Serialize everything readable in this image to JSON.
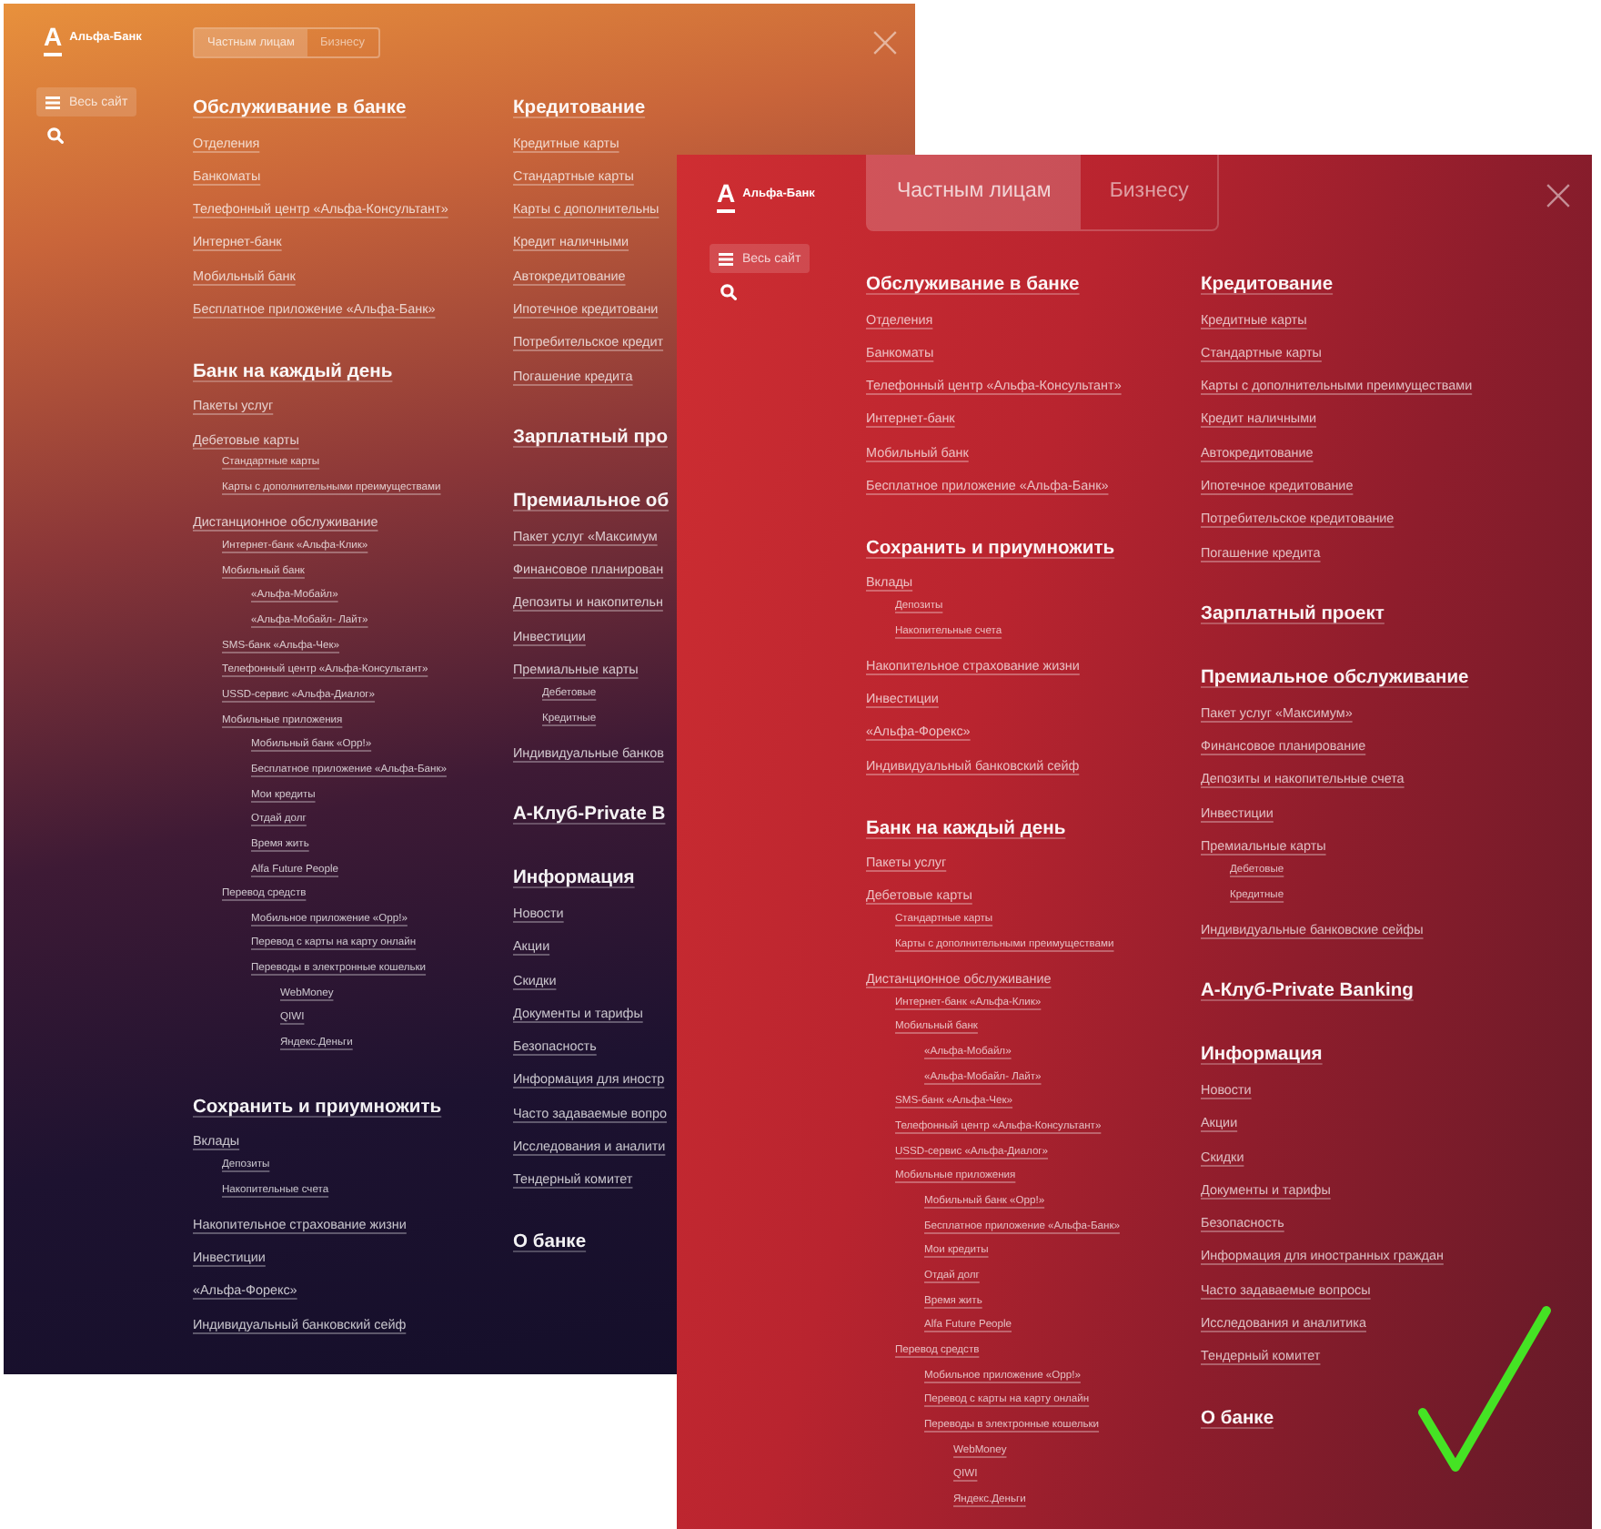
{
  "panels": [
    {
      "kind": "old",
      "logo": {
        "mark": "А",
        "name": "Альфа-Банк"
      },
      "tabs": [
        {
          "label": "Частным лицам",
          "selected": true
        },
        {
          "label": "Бизнесу",
          "selected": false
        }
      ],
      "all_site_button": "Весь сайт",
      "columns": [
        [
          {
            "heading": "Обслуживание в банке",
            "items": [
              {
                "label": "Отделения"
              },
              {
                "label": "Банкоматы"
              },
              {
                "label": "Телефонный центр «Альфа-Консультант»"
              },
              {
                "label": "Интернет-банк"
              },
              {
                "label": "Мобильный банк"
              },
              {
                "label": "Бесплатное приложение «Альфа-Банк»"
              }
            ]
          },
          {
            "heading": "Банк на каждый день",
            "items": [
              {
                "label": "Пакеты услуг"
              },
              {
                "label": "Дебетовые карты",
                "children": [
                  {
                    "label": "Стандартные карты"
                  },
                  {
                    "label": "Карты с дополнительными преимуществами"
                  }
                ]
              },
              {
                "label": "Дистанционное обслуживание",
                "children": [
                  {
                    "label": "Интернет-банк «Альфа-Клик»"
                  },
                  {
                    "label": "Мобильный банк",
                    "children": [
                      {
                        "label": "«Альфа-Мобайл»"
                      },
                      {
                        "label": "«Альфа-Мобайл- Лайт»"
                      }
                    ]
                  },
                  {
                    "label": "SMS-банк «Альфа-Чек»"
                  },
                  {
                    "label": "Телефонный центр «Альфа-Консультант»"
                  },
                  {
                    "label": "USSD-сервис «Альфа-Диалог»"
                  },
                  {
                    "label": "Мобильные приложения",
                    "children": [
                      {
                        "label": "Мобильный банк «Opp!»"
                      },
                      {
                        "label": "Бесплатное приложение «Альфа-Банк»"
                      },
                      {
                        "label": "Мои кредиты"
                      },
                      {
                        "label": "Отдай долг"
                      },
                      {
                        "label": "Время жить"
                      },
                      {
                        "label": "Alfa Future People"
                      }
                    ]
                  },
                  {
                    "label": "Перевод средств",
                    "children": [
                      {
                        "label": "Мобильное приложение «Opp!»"
                      },
                      {
                        "label": "Перевод с карты на карту онлайн"
                      },
                      {
                        "label": "Переводы в электронные кошельки",
                        "children": [
                          {
                            "label": "WebMoney"
                          },
                          {
                            "label": "QIWI"
                          },
                          {
                            "label": "Яндекс.Деньги"
                          }
                        ]
                      }
                    ]
                  }
                ]
              }
            ]
          },
          {
            "heading": "Сохранить и приумножить",
            "items": [
              {
                "label": "Вклады",
                "children": [
                  {
                    "label": "Депозиты"
                  },
                  {
                    "label": "Накопительные счета"
                  }
                ]
              },
              {
                "label": "Накопительное страхование жизни"
              },
              {
                "label": "Инвестиции"
              },
              {
                "label": "«Альфа-Форекс»"
              },
              {
                "label": "Индивидуальный банковский сейф"
              }
            ]
          }
        ],
        [
          {
            "heading": "Кредитование",
            "items": [
              {
                "label": "Кредитные карты"
              },
              {
                "label": "Стандартные карты"
              },
              {
                "label": "Карты с дополнительны"
              },
              {
                "label": "Кредит наличными"
              },
              {
                "label": "Автокредитование"
              },
              {
                "label": "Ипотечное кредитовани"
              },
              {
                "label": "Потребительское кредит"
              },
              {
                "label": "Погашение кредита"
              }
            ]
          },
          {
            "heading": "Зарплатный про"
          },
          {
            "heading": "Премиальное об",
            "items": [
              {
                "label": "Пакет услуг «Максимум"
              },
              {
                "label": "Финансовое планирован"
              },
              {
                "label": "Депозиты и накопительн"
              },
              {
                "label": "Инвестиции"
              },
              {
                "label": "Премиальные карты",
                "children": [
                  {
                    "label": "Дебетовые"
                  },
                  {
                    "label": "Кредитные"
                  }
                ]
              },
              {
                "label": "Индивидуальные банков"
              }
            ]
          },
          {
            "heading": "А-Клуб-Private B"
          },
          {
            "heading": "Информация",
            "items": [
              {
                "label": "Новости"
              },
              {
                "label": "Акции"
              },
              {
                "label": "Скидки"
              },
              {
                "label": "Документы и тарифы"
              },
              {
                "label": "Безопасность"
              },
              {
                "label": "Информация для иностр"
              },
              {
                "label": "Часто задаваемые вопро"
              },
              {
                "label": "Исследования и аналити"
              },
              {
                "label": "Тендерный комитет"
              }
            ]
          },
          {
            "heading": "О банке"
          }
        ]
      ]
    },
    {
      "kind": "new",
      "logo": {
        "mark": "А",
        "name": "Альфа-Банк"
      },
      "tabs": [
        {
          "label": "Частным лицам",
          "selected": true
        },
        {
          "label": "Бизнесу",
          "selected": false
        }
      ],
      "all_site_button": "Весь сайт",
      "columns": [
        [
          {
            "heading": "Обслуживание в банке",
            "items": [
              {
                "label": "Отделения"
              },
              {
                "label": "Банкоматы"
              },
              {
                "label": "Телефонный центр «Альфа-Консультант»"
              },
              {
                "label": "Интернет-банк"
              },
              {
                "label": "Мобильный банк"
              },
              {
                "label": "Бесплатное приложение «Альфа-Банк»"
              }
            ]
          },
          {
            "heading": "Сохранить и приумножить",
            "items": [
              {
                "label": "Вклады",
                "children": [
                  {
                    "label": "Депозиты"
                  },
                  {
                    "label": "Накопительные счета"
                  }
                ]
              },
              {
                "label": "Накопительное страхование жизни"
              },
              {
                "label": "Инвестиции"
              },
              {
                "label": "«Альфа-Форекс»"
              },
              {
                "label": "Индивидуальный банковский сейф"
              }
            ]
          },
          {
            "heading": "Банк на каждый день",
            "items": [
              {
                "label": "Пакеты услуг"
              },
              {
                "label": "Дебетовые карты",
                "children": [
                  {
                    "label": "Стандартные карты"
                  },
                  {
                    "label": "Карты с дополнительными преимуществами"
                  }
                ]
              },
              {
                "label": "Дистанционное обслуживание",
                "children": [
                  {
                    "label": "Интернет-банк «Альфа-Клик»"
                  },
                  {
                    "label": "Мобильный банк",
                    "children": [
                      {
                        "label": "«Альфа-Мобайл»"
                      },
                      {
                        "label": "«Альфа-Мобайл- Лайт»"
                      }
                    ]
                  },
                  {
                    "label": "SMS-банк «Альфа-Чек»"
                  },
                  {
                    "label": "Телефонный центр «Альфа-Консультант»"
                  },
                  {
                    "label": "USSD-сервис «Альфа-Диалог»"
                  },
                  {
                    "label": "Мобильные приложения",
                    "children": [
                      {
                        "label": "Мобильный банк «Opp!»"
                      },
                      {
                        "label": "Бесплатное приложение «Альфа-Банк»"
                      },
                      {
                        "label": "Мои кредиты"
                      },
                      {
                        "label": "Отдай долг"
                      },
                      {
                        "label": "Время жить"
                      },
                      {
                        "label": "Alfa Future People"
                      }
                    ]
                  },
                  {
                    "label": "Перевод средств",
                    "children": [
                      {
                        "label": "Мобильное приложение «Opp!»"
                      },
                      {
                        "label": "Перевод с карты на карту онлайн"
                      },
                      {
                        "label": "Переводы в электронные кошельки",
                        "children": [
                          {
                            "label": "WebMoney"
                          },
                          {
                            "label": "QIWI"
                          },
                          {
                            "label": "Яндекс.Деньги"
                          }
                        ]
                      }
                    ]
                  }
                ]
              }
            ]
          }
        ],
        [
          {
            "heading": "Кредитование",
            "items": [
              {
                "label": "Кредитные карты"
              },
              {
                "label": "Стандартные карты"
              },
              {
                "label": "Карты с дополнительными преимуществами"
              },
              {
                "label": "Кредит наличными"
              },
              {
                "label": "Автокредитование"
              },
              {
                "label": "Ипотечное кредитование"
              },
              {
                "label": "Потребительское кредитование"
              },
              {
                "label": "Погашение кредита"
              }
            ]
          },
          {
            "heading": "Зарплатный проект"
          },
          {
            "heading": "Премиальное обслуживание",
            "items": [
              {
                "label": "Пакет услуг «Максимум»"
              },
              {
                "label": "Финансовое планирование"
              },
              {
                "label": "Депозиты и накопительные счета"
              },
              {
                "label": "Инвестиции"
              },
              {
                "label": "Премиальные карты",
                "children": [
                  {
                    "label": "Дебетовые"
                  },
                  {
                    "label": "Кредитные"
                  }
                ]
              },
              {
                "label": "Индивидуальные банковские сейфы"
              }
            ]
          },
          {
            "heading": "А-Клуб-Private Banking"
          },
          {
            "heading": "Информация",
            "items": [
              {
                "label": "Новости"
              },
              {
                "label": "Акции"
              },
              {
                "label": "Скидки"
              },
              {
                "label": "Документы и тарифы"
              },
              {
                "label": "Безопасность"
              },
              {
                "label": "Информация для иностранных граждан"
              },
              {
                "label": "Часто задаваемые вопросы"
              },
              {
                "label": "Исследования и аналитика"
              },
              {
                "label": "Тендерный комитет"
              }
            ]
          },
          {
            "heading": "О банке"
          }
        ]
      ]
    }
  ]
}
